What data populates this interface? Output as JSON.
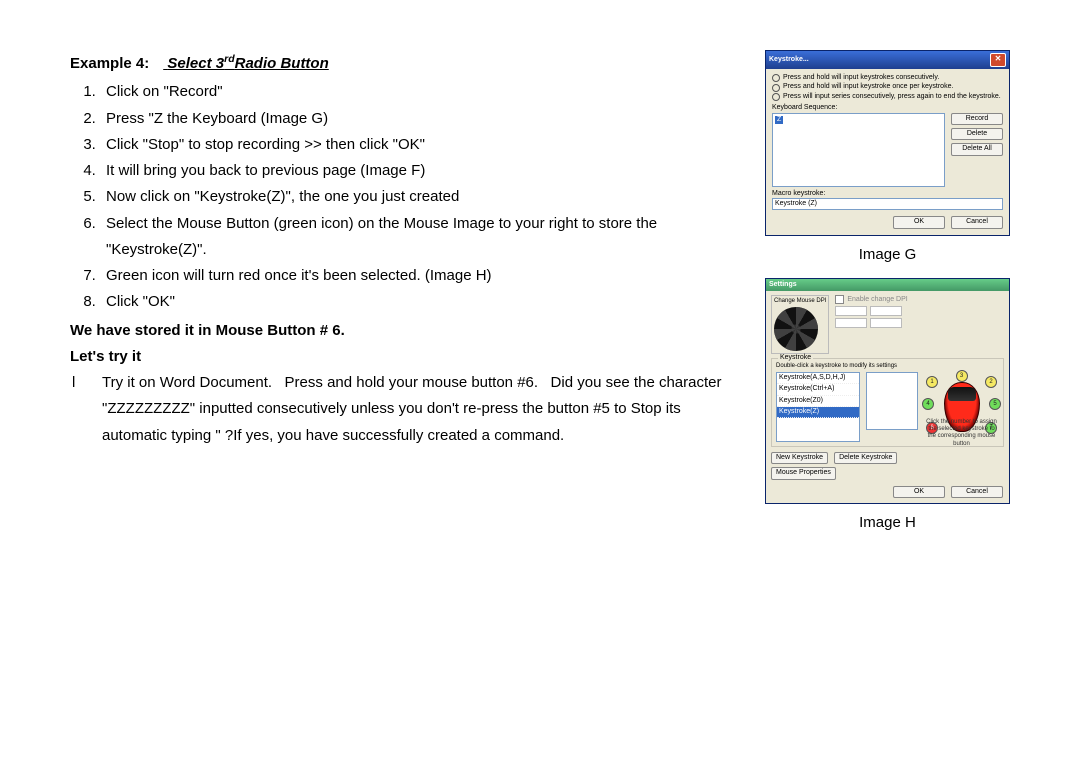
{
  "heading": {
    "prefix": "Example 4:",
    "title_a": "Select 3",
    "title_sup": "rd",
    "title_b": "Radio Button"
  },
  "steps": [
    "Click on \"Record\"",
    "Press \"Z the Keyboard (Image G)",
    "Click \"Stop\" to stop recording >> then click \"OK\"",
    "It will bring you back to previous page (Image F)",
    "Now click on \"Keystroke(Z)\", the one you just created",
    "Select the Mouse Button (green icon) on the Mouse Image to your right to store the \"Keystroke(Z)\".",
    "Green icon will turn red once it's been selected. (Image H)",
    "Click \"OK\""
  ],
  "stored_line": "We have stored it in Mouse Button # 6.",
  "lets_try": "Let's try it",
  "try_bullet": "l",
  "try_text": "Try it on Word Document.   Press and hold your mouse button #6.   Did you see the character \"ZZZZZZZZZ\" inputted consecutively unless you don't re-press the button #5 to Stop its automatic typing \" ?If yes, you have successfully created a command.",
  "captions": {
    "g": "Image G",
    "h": "Image H"
  },
  "dialogG": {
    "title": "Keystroke...",
    "radios": [
      "Press and hold will input keystrokes consecutively.",
      "Press and hold will input keystroke once per keystroke.",
      "Press will input series consecutively, press again to end the keystroke."
    ],
    "seq_label": "Keyboard Sequence:",
    "seq_item": "Z",
    "btn_record": "Record",
    "btn_delete": "Delete",
    "btn_deleteall": "Delete All",
    "macro_label": "Macro keystroke:",
    "macro_value": "Keystroke (Z)",
    "ok": "OK",
    "cancel": "Cancel"
  },
  "dialogH": {
    "title": "Settings",
    "tab": "Change Mouse DPI",
    "enable": "Enable change DPI",
    "group": "Keystroke",
    "hint": "Double-click a keystroke to modify its settings",
    "list": [
      "Keystroke(A,S,D,H,J)",
      "Keystroke(Ctrl+A)",
      "Keystroke(Z0)",
      "Keystroke(Z)"
    ],
    "mouse_nums": [
      "1",
      "2",
      "3",
      "4",
      "5",
      "6",
      "7"
    ],
    "mouse_hint": "Click the number to assign the selected keystroke to the corresponding mouse button",
    "new_ks": "New Keystroke",
    "del_ks": "Delete Keystroke",
    "mouse_prop": "Mouse Properties",
    "ok": "OK",
    "cancel": "Cancel"
  }
}
